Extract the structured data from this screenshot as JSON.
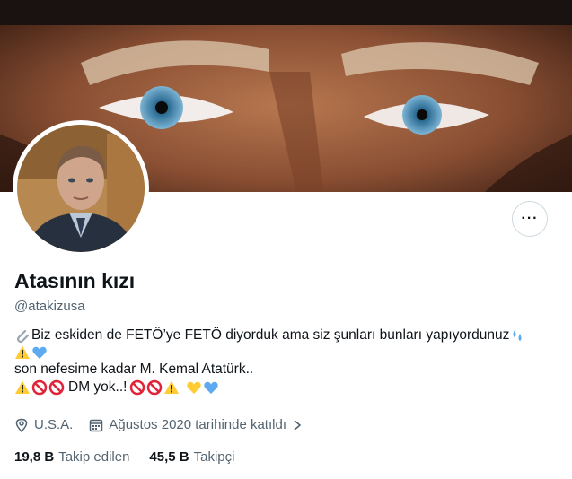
{
  "profile": {
    "display_name": "Atasının kızı",
    "handle": "@atakizusa",
    "more_icon": "more-horizontal-icon",
    "bio": {
      "line1": "Biz eskiden de FETÖ’ye FETÖ diyorduk ama siz şunları bunları yapıyordunuz",
      "line3": "son nefesime kadar M. Kemal Atatürk..",
      "line4_text": "DM yok..!"
    },
    "location": "U.S.A.",
    "joined": "Ağustos 2020 tarihinde katıldı",
    "following_count": "19,8 B",
    "following_label": "Takip edilen",
    "followers_count": "45,5 B",
    "followers_label": "Takipçi"
  },
  "colors": {
    "heart_blue": "#5daaf0",
    "heart_yellow": "#ffcc33",
    "warning_yellow": "#ffcc33",
    "prohibited_red": "#e0243a",
    "secondary_text": "#536471"
  }
}
